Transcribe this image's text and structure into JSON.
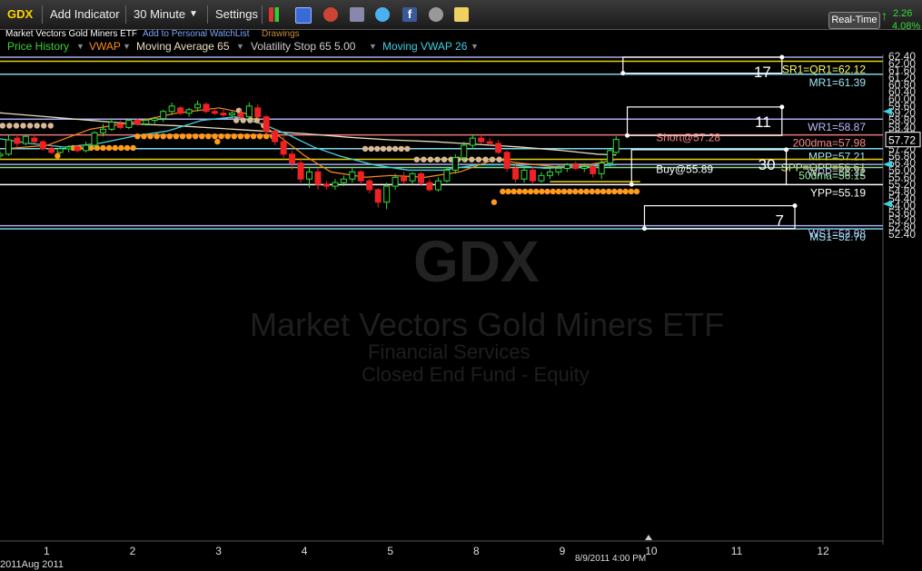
{
  "toolbar": {
    "symbol": "GDX",
    "add_indicator": "Add Indicator",
    "interval": "30 Minute",
    "settings": "Settings",
    "realtime": "Real-Time",
    "change": "2.26",
    "change_pct": "4.08%"
  },
  "subbar": {
    "name": "Market Vectors Gold Miners ETF",
    "watchlist": "Add to Personal WatchList",
    "drawings": "Drawings"
  },
  "indicators": [
    {
      "label": "Price History",
      "color": "#39d339"
    },
    {
      "label": "VWAP",
      "color": "#ff8c1a"
    },
    {
      "label": "Moving Average 65",
      "color": "#e8dcc0"
    },
    {
      "label": "Volatility Stop 65 5.00",
      "color": "#cccccc"
    },
    {
      "label": "Moving VWAP 26",
      "color": "#40d0e0"
    }
  ],
  "watermark": {
    "symbol": "GDX",
    "name": "Market Vectors Gold Miners ETF",
    "line3": "Financial Services",
    "line4": "Closed End Fund - Equity"
  },
  "footer": {
    "start_label": "2011Aug 2011",
    "cursor_label": "8/9/2011 4:00 PM"
  },
  "chart_data": {
    "type": "candlestick",
    "ylim": [
      52.2,
      62.6
    ],
    "y_ticks": [
      62.4,
      62.0,
      61.6,
      61.2,
      60.8,
      60.4,
      60.0,
      59.6,
      59.2,
      58.8,
      58.4,
      58.0,
      57.6,
      57.2,
      56.8,
      56.4,
      56.0,
      55.6,
      55.2,
      54.8,
      54.4,
      54.0,
      53.6,
      53.2,
      52.8,
      52.4
    ],
    "x_ticks": [
      {
        "label": "1",
        "day": 1
      },
      {
        "label": "2",
        "day": 2
      },
      {
        "label": "3",
        "day": 3
      },
      {
        "label": "4",
        "day": 4
      },
      {
        "label": "5",
        "day": 5
      },
      {
        "label": "8",
        "day": 6
      },
      {
        "label": "9",
        "day": 7
      },
      {
        "label": "10",
        "day": 8
      },
      {
        "label": "11",
        "day": 9
      },
      {
        "label": "12",
        "day": 10
      }
    ],
    "last_price": "57.72",
    "levels": [
      {
        "label": "SR1=QR1=62.12",
        "value": 62.12,
        "color": "#e6d200",
        "label_color": "#ffff66"
      },
      {
        "label": "",
        "value": 62.35,
        "color": "#aaaaee",
        "label_color": "#aaaaee"
      },
      {
        "label": "MR1=61.39",
        "value": 61.39,
        "color": "#7fd3e6",
        "label_color": "#9fe6f6"
      },
      {
        "label": "WR1=58.87",
        "value": 58.87,
        "color": "#aaaaee",
        "label_color": "#bbbbff"
      },
      {
        "label": "200dma=57.98",
        "value": 57.98,
        "color": "#e87a7a",
        "label_color": "#ff8a8a"
      },
      {
        "label": "MPP=57.21",
        "value": 57.21,
        "color": "#7fd3e6",
        "label_color": "#9fe6f6"
      },
      {
        "label": "SPP=QPP=56.61",
        "value": 56.61,
        "color": "#e6d200",
        "label_color": "#ffff66"
      },
      {
        "label": "WPP=56.32",
        "value": 56.32,
        "color": "#aaaaee",
        "label_color": "#bbbbff"
      },
      {
        "label": "50dma=56.15",
        "value": 56.15,
        "color": "#88dd88",
        "label_color": "#99ee99"
      },
      {
        "label": "YPP=55.19",
        "value": 55.19,
        "color": "#ffffff",
        "label_color": "#ffffff"
      },
      {
        "label": "WS1=52.88",
        "value": 52.88,
        "color": "#aaaaee",
        "label_color": "#bbbbff"
      },
      {
        "label": "MS1=52.70",
        "value": 52.7,
        "color": "#7fd3e6",
        "label_color": "#9fe6f6"
      }
    ],
    "boxes": [
      {
        "label": "17",
        "day_from": 7.7,
        "day_to": 9.55,
        "y_top": 62.35,
        "y_bottom": 61.45
      },
      {
        "label": "11",
        "day_from": 7.75,
        "day_to": 9.55,
        "y_top": 59.55,
        "y_bottom": 57.95
      },
      {
        "label": "30",
        "day_from": 7.8,
        "day_to": 9.6,
        "y_top": 57.15,
        "y_bottom": 55.2
      },
      {
        "label": "7",
        "day_from": 7.95,
        "day_to": 9.7,
        "y_top": 54.0,
        "y_bottom": 52.72
      }
    ],
    "annotations": [
      {
        "text": "Short@57.28",
        "day": 8.0,
        "value": 57.62,
        "color": "#ff8a8a"
      },
      {
        "text": "Buy@55.89",
        "day": 8.0,
        "value": 55.85,
        "color": "#ffffff"
      }
    ],
    "candles": [
      {
        "day": 0.05,
        "o": 57.15,
        "h": 57.3,
        "l": 56.85,
        "c": 57.0
      },
      {
        "day": 0.15,
        "o": 57.0,
        "h": 57.2,
        "l": 56.7,
        "c": 56.9
      },
      {
        "day": 0.25,
        "o": 56.9,
        "h": 57.1,
        "l": 56.75,
        "c": 56.95
      },
      {
        "day": 0.35,
        "o": 56.95,
        "h": 57.1,
        "l": 56.7,
        "c": 56.8
      },
      {
        "day": 0.45,
        "o": 56.8,
        "h": 57.05,
        "l": 56.6,
        "c": 56.9
      },
      {
        "day": 0.55,
        "o": 56.9,
        "h": 58.0,
        "l": 56.8,
        "c": 57.7
      },
      {
        "day": 0.65,
        "o": 57.8,
        "h": 58.0,
        "l": 57.3,
        "c": 57.5
      },
      {
        "day": 0.75,
        "o": 57.5,
        "h": 58.0,
        "l": 57.4,
        "c": 57.9
      },
      {
        "day": 0.85,
        "o": 57.8,
        "h": 58.0,
        "l": 57.5,
        "c": 57.6
      },
      {
        "day": 0.95,
        "o": 57.6,
        "h": 57.7,
        "l": 57.1,
        "c": 57.2
      },
      {
        "day": 1.05,
        "o": 57.2,
        "h": 57.5,
        "l": 56.9,
        "c": 57.0
      },
      {
        "day": 1.15,
        "o": 57.0,
        "h": 57.3,
        "l": 56.9,
        "c": 57.2
      },
      {
        "day": 1.25,
        "o": 57.2,
        "h": 57.4,
        "l": 57.0,
        "c": 57.3
      },
      {
        "day": 1.35,
        "o": 57.3,
        "h": 57.4,
        "l": 57.0,
        "c": 57.1
      },
      {
        "day": 1.45,
        "o": 57.1,
        "h": 57.6,
        "l": 57.0,
        "c": 57.4
      },
      {
        "day": 1.55,
        "o": 57.4,
        "h": 58.2,
        "l": 57.3,
        "c": 58.1
      },
      {
        "day": 1.65,
        "o": 58.1,
        "h": 58.6,
        "l": 57.9,
        "c": 58.3
      },
      {
        "day": 1.75,
        "o": 58.3,
        "h": 58.9,
        "l": 58.2,
        "c": 58.7
      },
      {
        "day": 1.85,
        "o": 58.6,
        "h": 58.8,
        "l": 58.3,
        "c": 58.4
      },
      {
        "day": 1.95,
        "o": 58.4,
        "h": 58.9,
        "l": 58.3,
        "c": 58.8
      },
      {
        "day": 2.05,
        "o": 58.8,
        "h": 58.9,
        "l": 58.5,
        "c": 58.6
      },
      {
        "day": 2.15,
        "o": 58.6,
        "h": 58.9,
        "l": 58.5,
        "c": 58.8
      },
      {
        "day": 2.25,
        "o": 58.8,
        "h": 59.0,
        "l": 58.6,
        "c": 58.9
      },
      {
        "day": 2.35,
        "o": 58.9,
        "h": 59.4,
        "l": 58.7,
        "c": 59.3
      },
      {
        "day": 2.45,
        "o": 59.3,
        "h": 59.8,
        "l": 59.1,
        "c": 59.6
      },
      {
        "day": 2.55,
        "o": 59.5,
        "h": 59.6,
        "l": 59.1,
        "c": 59.2
      },
      {
        "day": 2.65,
        "o": 59.2,
        "h": 59.5,
        "l": 59.0,
        "c": 59.4
      },
      {
        "day": 2.75,
        "o": 59.5,
        "h": 59.9,
        "l": 59.3,
        "c": 59.7
      },
      {
        "day": 2.85,
        "o": 59.7,
        "h": 59.8,
        "l": 59.2,
        "c": 59.3
      },
      {
        "day": 2.95,
        "o": 59.3,
        "h": 59.5,
        "l": 59.1,
        "c": 59.2
      },
      {
        "day": 3.05,
        "o": 59.2,
        "h": 59.4,
        "l": 59.0,
        "c": 59.1
      },
      {
        "day": 3.15,
        "o": 59.1,
        "h": 59.3,
        "l": 58.9,
        "c": 59.2
      },
      {
        "day": 3.25,
        "o": 59.2,
        "h": 59.4,
        "l": 58.9,
        "c": 59.0
      },
      {
        "day": 3.35,
        "o": 59.0,
        "h": 59.8,
        "l": 58.9,
        "c": 59.6
      },
      {
        "day": 3.45,
        "o": 59.5,
        "h": 59.7,
        "l": 58.9,
        "c": 59.0
      },
      {
        "day": 3.55,
        "o": 59.0,
        "h": 59.1,
        "l": 58.0,
        "c": 58.2
      },
      {
        "day": 3.65,
        "o": 58.2,
        "h": 58.3,
        "l": 57.4,
        "c": 57.6
      },
      {
        "day": 3.75,
        "o": 57.6,
        "h": 57.9,
        "l": 56.7,
        "c": 56.9
      },
      {
        "day": 3.85,
        "o": 56.9,
        "h": 57.1,
        "l": 56.0,
        "c": 56.4
      },
      {
        "day": 3.95,
        "o": 56.4,
        "h": 56.7,
        "l": 55.3,
        "c": 55.5
      },
      {
        "day": 4.05,
        "o": 55.5,
        "h": 56.2,
        "l": 55.0,
        "c": 55.9
      },
      {
        "day": 4.15,
        "o": 55.9,
        "h": 56.1,
        "l": 54.9,
        "c": 55.2
      },
      {
        "day": 4.25,
        "o": 55.2,
        "h": 55.4,
        "l": 54.9,
        "c": 55.1
      },
      {
        "day": 4.35,
        "o": 55.1,
        "h": 55.5,
        "l": 54.9,
        "c": 55.3
      },
      {
        "day": 4.45,
        "o": 55.3,
        "h": 55.7,
        "l": 55.1,
        "c": 55.5
      },
      {
        "day": 4.55,
        "o": 55.5,
        "h": 56.1,
        "l": 55.3,
        "c": 55.9
      },
      {
        "day": 4.65,
        "o": 55.9,
        "h": 56.0,
        "l": 55.2,
        "c": 55.4
      },
      {
        "day": 4.75,
        "o": 55.4,
        "h": 55.5,
        "l": 54.7,
        "c": 54.9
      },
      {
        "day": 4.85,
        "o": 54.9,
        "h": 55.0,
        "l": 53.9,
        "c": 54.2
      },
      {
        "day": 4.95,
        "o": 54.2,
        "h": 55.3,
        "l": 53.8,
        "c": 55.1
      },
      {
        "day": 5.05,
        "o": 55.1,
        "h": 55.8,
        "l": 54.9,
        "c": 55.6
      },
      {
        "day": 5.15,
        "o": 55.6,
        "h": 55.9,
        "l": 55.2,
        "c": 55.4
      },
      {
        "day": 5.25,
        "o": 55.4,
        "h": 55.9,
        "l": 55.2,
        "c": 55.8
      },
      {
        "day": 5.35,
        "o": 55.8,
        "h": 55.9,
        "l": 55.1,
        "c": 55.3
      },
      {
        "day": 5.45,
        "o": 55.3,
        "h": 55.5,
        "l": 54.8,
        "c": 54.9
      },
      {
        "day": 5.55,
        "o": 54.9,
        "h": 55.6,
        "l": 54.8,
        "c": 55.4
      },
      {
        "day": 5.65,
        "o": 55.4,
        "h": 56.2,
        "l": 55.3,
        "c": 56.0
      },
      {
        "day": 5.75,
        "o": 56.0,
        "h": 56.9,
        "l": 55.8,
        "c": 56.7
      },
      {
        "day": 5.85,
        "o": 56.7,
        "h": 57.6,
        "l": 56.5,
        "c": 57.4
      },
      {
        "day": 5.95,
        "o": 57.4,
        "h": 58.0,
        "l": 57.2,
        "c": 57.8
      },
      {
        "day": 6.05,
        "o": 57.8,
        "h": 58.0,
        "l": 57.5,
        "c": 57.6
      },
      {
        "day": 6.15,
        "o": 57.6,
        "h": 57.8,
        "l": 57.4,
        "c": 57.5
      },
      {
        "day": 6.25,
        "o": 57.5,
        "h": 57.7,
        "l": 56.9,
        "c": 57.0
      },
      {
        "day": 6.35,
        "o": 57.0,
        "h": 57.1,
        "l": 55.9,
        "c": 56.1
      },
      {
        "day": 6.45,
        "o": 56.1,
        "h": 56.4,
        "l": 55.3,
        "c": 55.5
      },
      {
        "day": 6.55,
        "o": 55.5,
        "h": 56.2,
        "l": 55.3,
        "c": 56.0
      },
      {
        "day": 6.65,
        "o": 56.0,
        "h": 56.2,
        "l": 55.2,
        "c": 55.4
      },
      {
        "day": 6.75,
        "o": 55.4,
        "h": 55.9,
        "l": 55.3,
        "c": 55.7
      },
      {
        "day": 6.85,
        "o": 55.7,
        "h": 56.2,
        "l": 55.5,
        "c": 55.9
      },
      {
        "day": 6.95,
        "o": 55.9,
        "h": 56.3,
        "l": 55.7,
        "c": 56.1
      },
      {
        "day": 7.05,
        "o": 56.1,
        "h": 56.4,
        "l": 55.9,
        "c": 56.3
      },
      {
        "day": 7.15,
        "o": 56.3,
        "h": 56.5,
        "l": 56.0,
        "c": 56.1
      },
      {
        "day": 7.25,
        "o": 56.1,
        "h": 56.4,
        "l": 55.9,
        "c": 56.2
      },
      {
        "day": 7.35,
        "o": 56.2,
        "h": 56.3,
        "l": 55.6,
        "c": 55.8
      },
      {
        "day": 7.45,
        "o": 55.8,
        "h": 56.6,
        "l": 55.5,
        "c": 56.4
      },
      {
        "day": 7.55,
        "o": 56.4,
        "h": 57.2,
        "l": 56.2,
        "c": 57.1
      },
      {
        "day": 7.62,
        "o": 57.0,
        "h": 57.9,
        "l": 56.9,
        "c": 57.72
      }
    ]
  }
}
